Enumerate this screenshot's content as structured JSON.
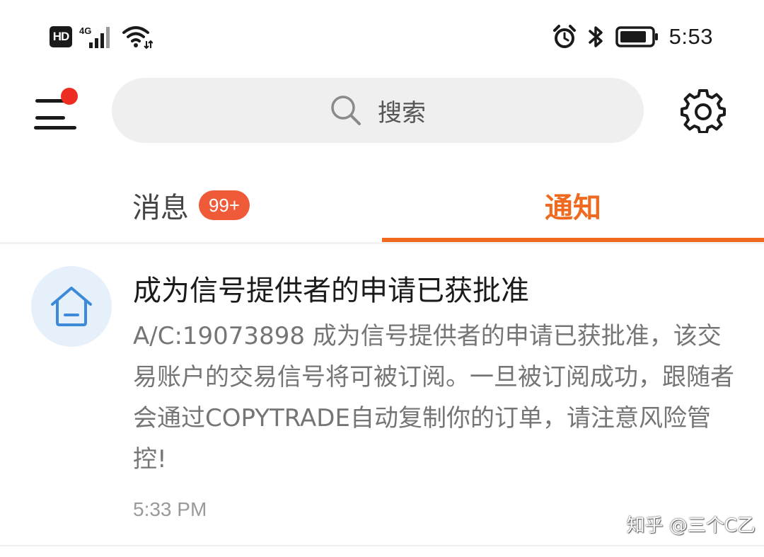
{
  "status_bar": {
    "hd_label": "HD",
    "network_generation": "4G",
    "time": "5:53",
    "icons": [
      "hd-icon",
      "signal-icon",
      "wifi-icon",
      "alarm-icon",
      "bluetooth-icon",
      "battery-icon"
    ],
    "battery_level": 0.85
  },
  "toolbar": {
    "search_placeholder": "搜索",
    "menu_has_notification_dot": true,
    "icons": [
      "menu-icon",
      "search-icon",
      "gear-icon"
    ]
  },
  "tabs": [
    {
      "label": "消息",
      "badge": "99+",
      "active": false
    },
    {
      "label": "通知",
      "active": true
    }
  ],
  "notifications": [
    {
      "icon": "home-icon",
      "title": "成为信号提供者的申请已获批准",
      "body": "A/C:19073898 成为信号提供者的申请已获批准，该交易账户的交易信号将可被订阅。一旦被订阅成功，跟随者会通过COPYTRADE自动复制你的订单，请注意风险管控!",
      "time": "5:33 PM"
    }
  ],
  "watermark": "知乎 @三个C乙",
  "colors": {
    "accent": "#ef6a1f",
    "badge": "#ef5a39",
    "notification_dot": "#ee2d22",
    "icon_blue": "#3d8ad8",
    "search_bg": "#efefef"
  }
}
